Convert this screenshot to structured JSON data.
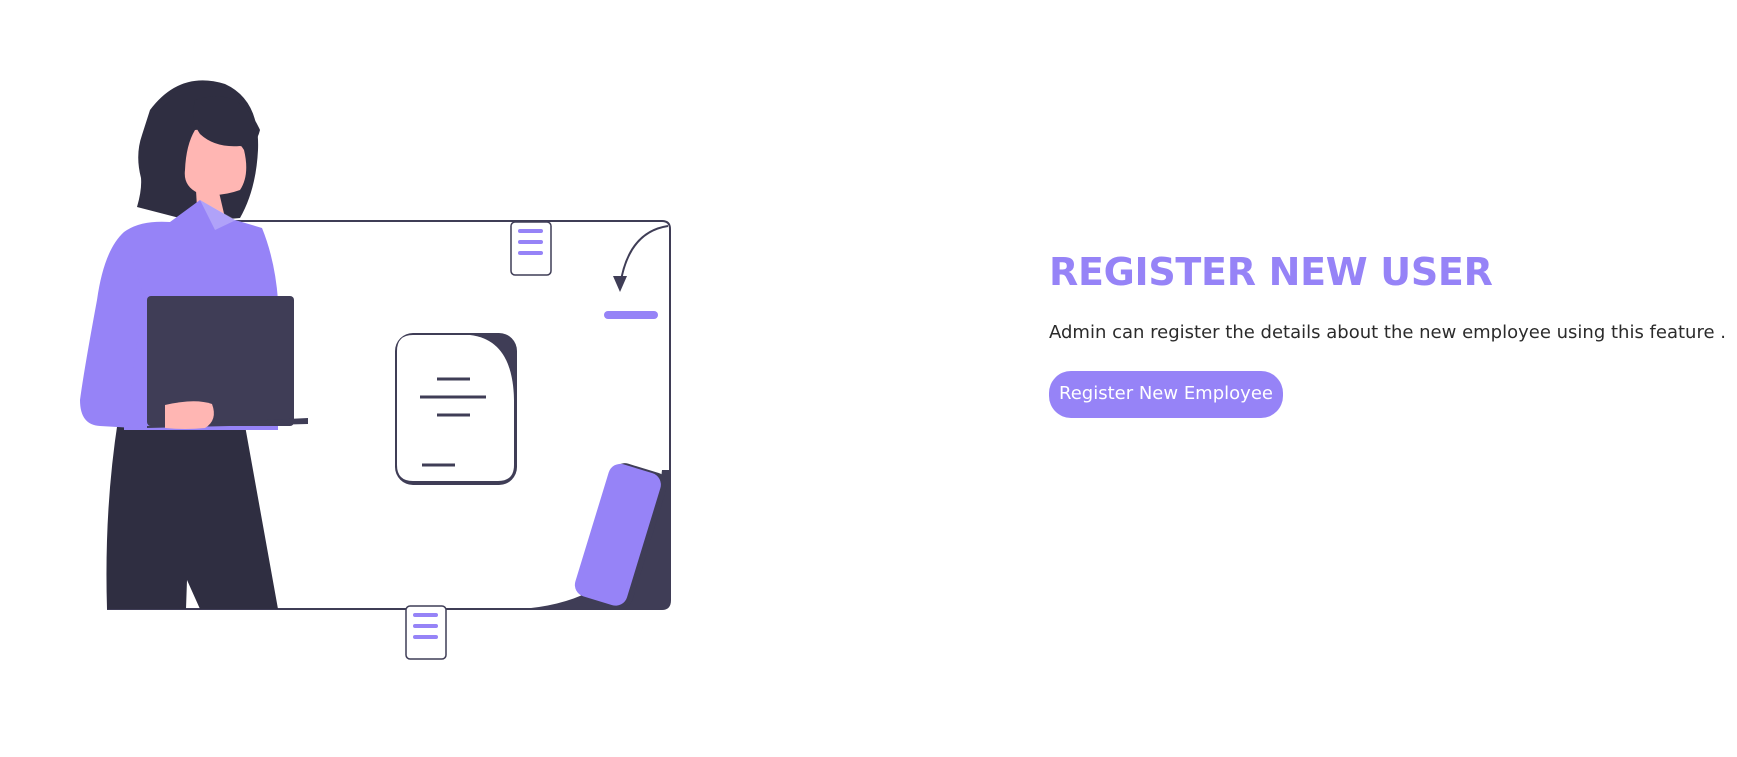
{
  "hero": {
    "title": "REGISTER NEW USER",
    "description": "Admin can register the details about the new employee using this feature .",
    "button_label": "Register New Employee"
  },
  "illustration": {
    "icon": "woman-with-laptop-dashboard-illustration"
  },
  "colors": {
    "accent": "#9683f7",
    "dark": "#3f3d56",
    "dark_clothes": "#2f2e41",
    "skin": "#ffb6b3",
    "text": "#2b2b2b"
  }
}
